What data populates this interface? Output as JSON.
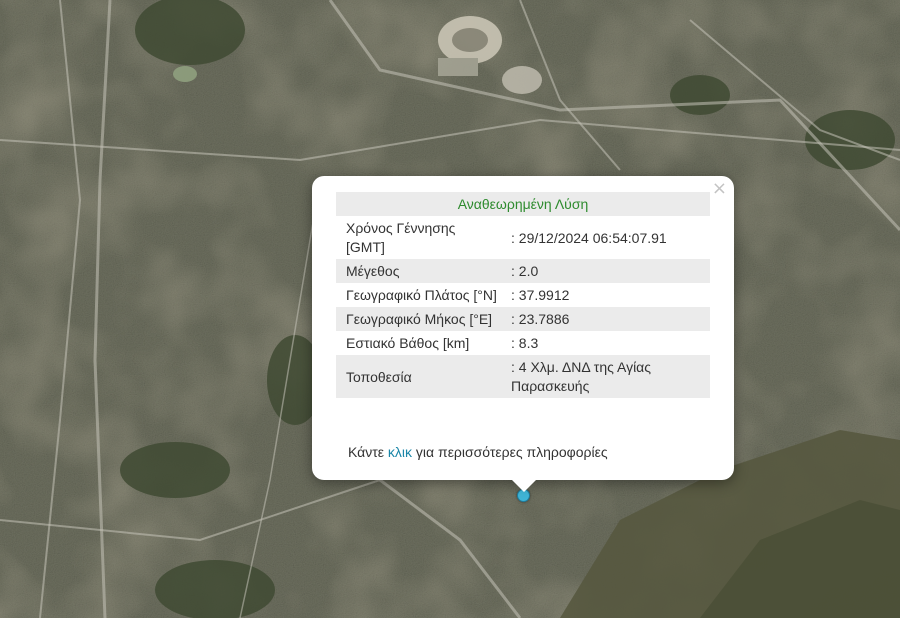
{
  "popup": {
    "close_glyph": "×",
    "header": "Αναθεωρημένη Λύση",
    "header_color": "#2e8b2e",
    "rows": [
      {
        "label": "Χρόνος Γέννησης [GMT]",
        "value": ": 29/12/2024 06:54:07.91"
      },
      {
        "label": "Μέγεθος",
        "value": ": 2.0"
      },
      {
        "label": "Γεωγραφικό Πλάτος [°N]",
        "value": ": 37.9912"
      },
      {
        "label": "Γεωγραφικό Μήκος [°E]",
        "value": ": 23.7886"
      },
      {
        "label": "Εστιακό Βάθος [km]",
        "value": ": 8.3"
      },
      {
        "label": "Τοποθεσία",
        "value": ": 4 Χλμ. ΔΝΔ της Αγίας Παρασκευής"
      }
    ],
    "footer": {
      "prefix": "Κάντε ",
      "link": "κλικ",
      "suffix": " για περισσότερες πληροφορίες",
      "link_color": "#1a86a8"
    }
  },
  "map": {
    "layer": "satellite imagery",
    "marker_icon": "epicenter-marker-icon",
    "marker_color": "#3fb4d6"
  }
}
